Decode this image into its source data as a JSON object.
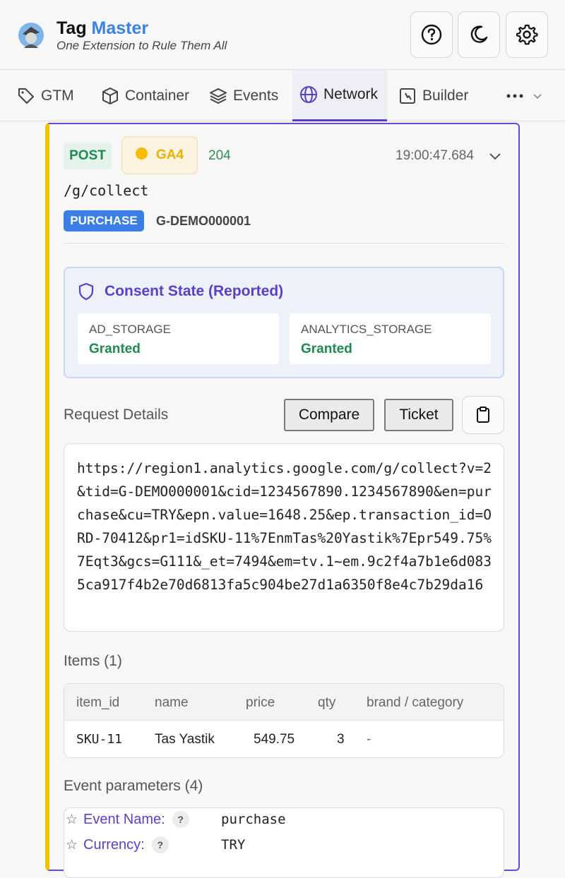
{
  "app": {
    "title_main": "Tag",
    "title_accent": "Master",
    "subtitle": "One Extension to Rule Them All"
  },
  "header_buttons": [
    "help-icon",
    "moon-icon",
    "gear-icon"
  ],
  "tabs": [
    {
      "label": "GTM",
      "icon": "tag-icon"
    },
    {
      "label": "Container",
      "icon": "cube-icon"
    },
    {
      "label": "Events",
      "icon": "layers-icon"
    },
    {
      "label": "Network",
      "icon": "globe-icon",
      "active": true
    },
    {
      "label": "Builder",
      "icon": "builder-icon"
    }
  ],
  "request": {
    "method": "POST",
    "vendor": "GA4",
    "status": "204",
    "time": "19:00:47.684",
    "path": "/g/collect",
    "event_badge": "PURCHASE",
    "measurement_id": "G-DEMO000001"
  },
  "consent": {
    "title": "Consent State (Reported)",
    "items": [
      {
        "label": "AD_STORAGE",
        "value": "Granted"
      },
      {
        "label": "ANALYTICS_STORAGE",
        "value": "Granted"
      }
    ]
  },
  "details": {
    "title": "Request Details",
    "compare_label": "Compare",
    "ticket_label": "Ticket",
    "url": "https://region1.analytics.google.com/g/collect?v=2&tid=G-DEMO000001&cid=1234567890.1234567890&en=purchase&cu=TRY&epn.value=1648.25&ep.transaction_id=ORD-70412&pr1=idSKU-11%7EnmTas%20Yastik%7Epr549.75%7Eqt3&gcs=G111&_et=7494&em=tv.1~em.9c2f4a7b1e6d0835ca917f4b2e70d6813fa5c904be27d1a6350f8e4c7b29da16"
  },
  "items": {
    "title": "Items (1)",
    "columns": [
      "item_id",
      "name",
      "price",
      "qty",
      "brand / category"
    ],
    "rows": [
      [
        "SKU-11",
        "Tas Yastik",
        "549.75",
        "3",
        "-"
      ]
    ]
  },
  "params": {
    "title": "Event parameters (4)",
    "rows": [
      {
        "name": "Event Name:",
        "value": "purchase"
      },
      {
        "name": "Currency:",
        "value": "TRY"
      }
    ]
  },
  "colors": {
    "accent": "#5b3fc8",
    "brand": "#3b82e6",
    "vendor": "#f5bd00",
    "success": "#1f8a4e"
  }
}
